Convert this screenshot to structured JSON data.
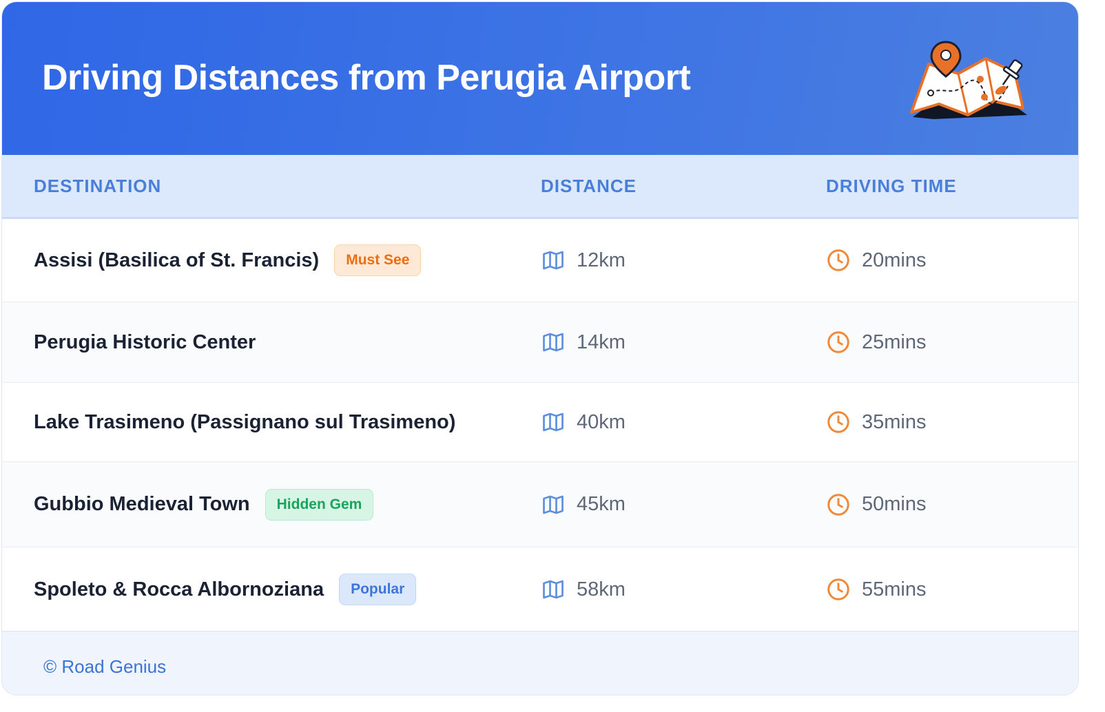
{
  "header": {
    "title": "Driving Distances from Perugia Airport",
    "illustration": "folded-map-with-pins-icon"
  },
  "table": {
    "columns": [
      "DESTINATION",
      "DISTANCE",
      "DRIVING TIME"
    ],
    "rows": [
      {
        "destination": "Assisi (Basilica of St. Francis)",
        "badge": "Must See",
        "badge_color": "#ed6d12",
        "distance": "12km",
        "time": "20mins"
      },
      {
        "destination": "Perugia Historic Center",
        "badge": "",
        "badge_color": "",
        "distance": "14km",
        "time": "25mins"
      },
      {
        "destination": "Lake Trasimeno (Passignano sul Trasimeno)",
        "badge": "",
        "badge_color": "",
        "distance": "40km",
        "time": "35mins"
      },
      {
        "destination": "Gubbio Medieval Town",
        "badge": "Hidden Gem",
        "badge_color": "#18a45c",
        "distance": "45km",
        "time": "50mins"
      },
      {
        "destination": "Spoleto & Rocca Albornoziana",
        "badge": "Popular",
        "badge_color": "#3c76dd",
        "distance": "58km",
        "time": "55mins"
      }
    ],
    "distance_icon": "map-icon",
    "time_icon": "clock-icon"
  },
  "footer": {
    "copyright": "© Road Genius"
  },
  "colors": {
    "header_bg": "#2f67e6",
    "column_header_text": "#4a7fd9",
    "clock_icon": "#f0893a",
    "map_icon": "#5d8fdc"
  }
}
